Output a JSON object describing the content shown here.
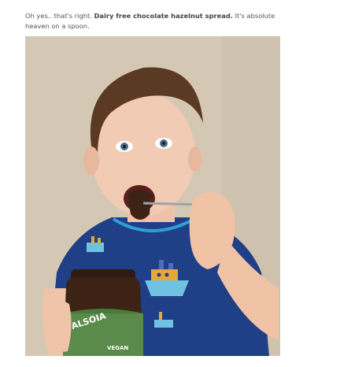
{
  "post": {
    "intro_text_before": "Oh yes.. that's right. ",
    "intro_bold": "Dairy free chocolate hazelnut spread.",
    "intro_text_after": " It's absolute heaven on a spoon."
  },
  "photo": {
    "jar_brand": "ALSOIA",
    "jar_label": "VEGAN"
  },
  "colors": {
    "background": "#ffffff",
    "body_text": "#555555",
    "wall": "#d5c9b6",
    "shirt": "#1f3f86",
    "chocolate": "#3c2316"
  }
}
